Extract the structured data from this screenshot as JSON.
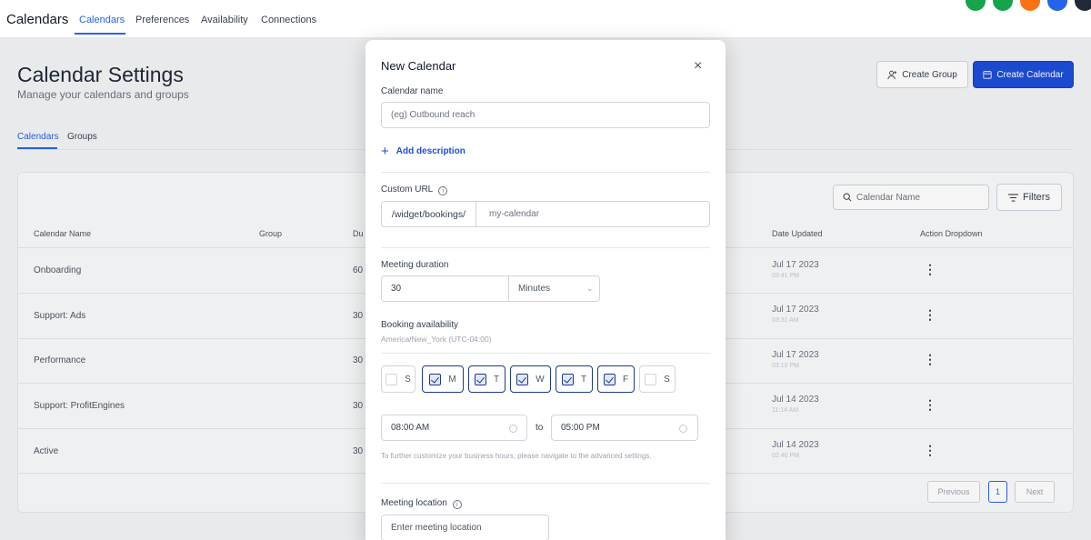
{
  "app": {
    "title": "Calendars"
  },
  "nav": {
    "tabs": [
      "Calendars",
      "Preferences",
      "Availability",
      "Connections"
    ],
    "active": "Calendars"
  },
  "avatars": [
    "#16a34a",
    "#16a34a",
    "#f97316",
    "#2563eb",
    "#1f2937"
  ],
  "page": {
    "title": "Calendar Settings",
    "subtitle": "Manage your calendars and groups",
    "create_group": "Create Group",
    "create_calendar": "Create Calendar",
    "subtabs": [
      "Calendars",
      "Groups"
    ]
  },
  "table": {
    "search_placeholder": "Calendar Name",
    "filters_label": "Filters",
    "columns": {
      "name": "Calendar Name",
      "group": "Group",
      "duration": "Du",
      "updated": "Date Updated",
      "action": "Action Dropdown"
    },
    "rows": [
      {
        "name": "Onboarding",
        "duration": "60",
        "date": "Jul 17 2023",
        "time": "03:41 PM"
      },
      {
        "name": "Support: Ads",
        "duration": "30",
        "date": "Jul 17 2023",
        "time": "03:31 AM"
      },
      {
        "name": "Performance",
        "duration": "30",
        "date": "Jul 17 2023",
        "time": "03:10 PM"
      },
      {
        "name": "Support: ProfitEngines",
        "duration": "30",
        "date": "Jul 14 2023",
        "time": "11:14 AM"
      },
      {
        "name": "Active",
        "duration": "30",
        "date": "Jul 14 2023",
        "time": "02:40 PM"
      }
    ],
    "pagination": {
      "previous": "Previous",
      "page": "1",
      "next": "Next"
    }
  },
  "modal": {
    "title": "New Calendar",
    "close": "×",
    "calendar_name_label": "Calendar name",
    "calendar_name_placeholder": "(eg) Outbound reach",
    "add_description": "Add description",
    "custom_url_label": "Custom URL",
    "url_prefix": "/widget/bookings/",
    "url_placeholder": "my-calendar",
    "duration_label": "Meeting duration",
    "duration_value": "30",
    "duration_unit": "Minutes",
    "availability_label": "Booking availability",
    "timezone": "America/New_York (UTC-04:00)",
    "days": [
      {
        "letter": "S",
        "checked": false
      },
      {
        "letter": "M",
        "checked": true
      },
      {
        "letter": "T",
        "checked": true
      },
      {
        "letter": "W",
        "checked": true
      },
      {
        "letter": "T",
        "checked": true
      },
      {
        "letter": "F",
        "checked": true
      },
      {
        "letter": "S",
        "checked": false
      }
    ],
    "start_time": "08:00 AM",
    "to_label": "to",
    "end_time": "05:00 PM",
    "hint": "To further customize your business hours, please navigate to the advanced settings.",
    "location_label": "Meeting location",
    "location_placeholder": "Enter meeting location"
  }
}
